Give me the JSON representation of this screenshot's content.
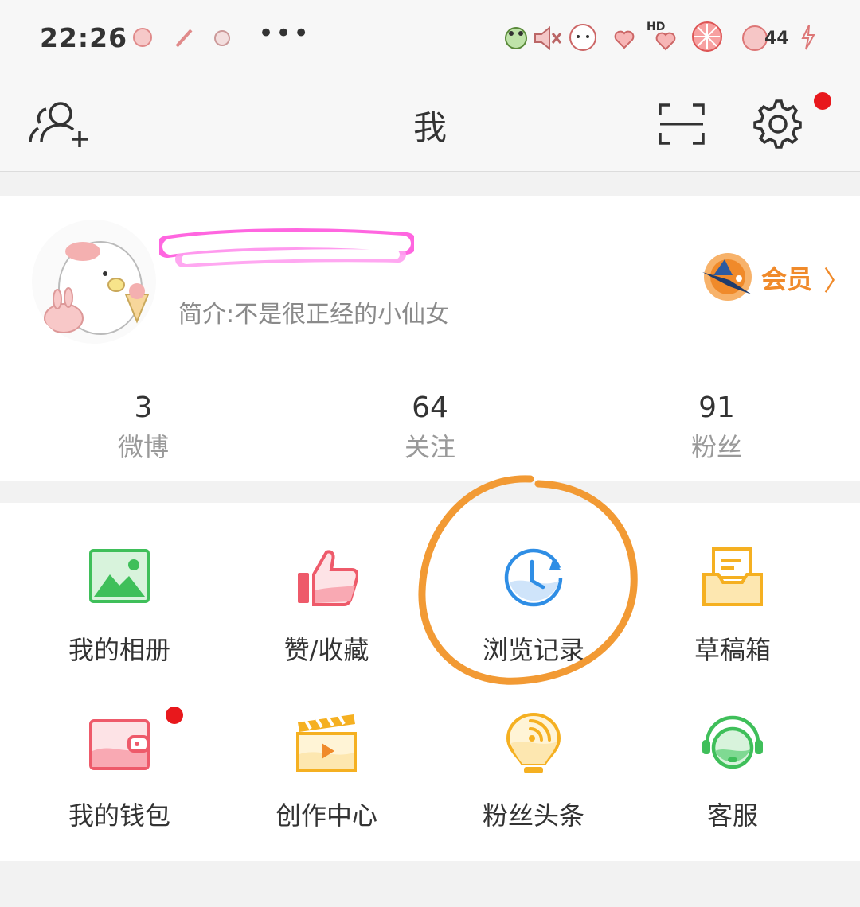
{
  "status_bar": {
    "time": "22:26",
    "battery": "44"
  },
  "header": {
    "title": "我"
  },
  "profile": {
    "bio": "简介:不是很正经的小仙女",
    "vip_label": "会员",
    "vip_arrow": "〉"
  },
  "stats": [
    {
      "count": "3",
      "label": "微博"
    },
    {
      "count": "64",
      "label": "关注"
    },
    {
      "count": "91",
      "label": "粉丝"
    }
  ],
  "grid": [
    {
      "label": "我的相册",
      "icon": "photo-album-icon"
    },
    {
      "label": "赞/收藏",
      "icon": "thumbs-up-icon"
    },
    {
      "label": "浏览记录",
      "icon": "history-clock-icon"
    },
    {
      "label": "草稿箱",
      "icon": "drafts-tray-icon"
    },
    {
      "label": "我的钱包",
      "icon": "wallet-icon"
    },
    {
      "label": "创作中心",
      "icon": "clapperboard-icon"
    },
    {
      "label": "粉丝头条",
      "icon": "fan-headline-bulb-icon"
    },
    {
      "label": "客服",
      "icon": "customer-service-headset-icon"
    }
  ],
  "colors": {
    "accent_orange": "#f08a2a",
    "annotation_orange": "#f29a34",
    "badge_red": "#e8181c"
  }
}
